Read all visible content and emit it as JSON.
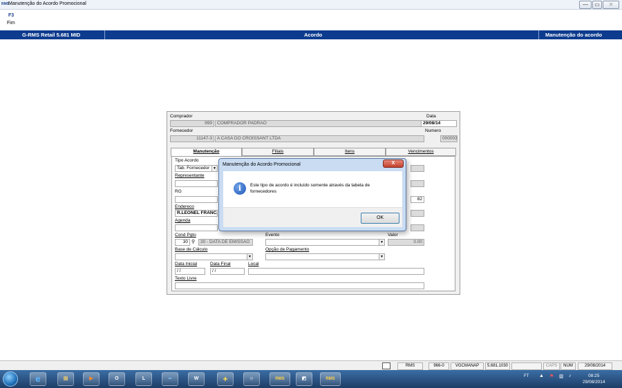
{
  "window": {
    "title": "Manutenção do Acordo Promocional",
    "app_icon": "RMS",
    "minimize": "—",
    "maximize": "▭",
    "close": "✕"
  },
  "toolbar": {
    "key": "F3",
    "label": "Fim"
  },
  "header": {
    "left": "G-RMS Retail 5.681 MID",
    "center": "Acordo",
    "right": "Manutenção do acordo"
  },
  "form": {
    "comprador_label": "Comprador",
    "comprador_code": "999",
    "comprador_name": "COMPRADOR PADRAO",
    "data_label": "Data",
    "data_value": "29/08/14",
    "fornecedor_label": "Fornecedor",
    "fornecedor_code": "11147-3",
    "fornecedor_name": "A CASA DO CROISSANT LTDA",
    "numero_label": "Numero",
    "numero_value": "00000361",
    "tabs": [
      "Manutenção",
      "Filiais",
      "Itens",
      "Vencimentos"
    ],
    "tipo_acordo_label": "Tipo Acordo",
    "tipo_acordo_value": "Tab. Fornecedor",
    "representante_label": "Representante",
    "rg_label": "RG",
    "endereco_label": "Endereco",
    "endereco_value": "R.LEONEL FRANCA",
    "agenda_label": "Agenda",
    "cond_pgto_label": "Cond Pgto",
    "cond_pgto_code": "30",
    "cond_pgto_desc": "30 - DATA DE EMISSAO",
    "evento_label": "Evento",
    "valor_label": "Valor",
    "valor_value": "0.00",
    "base_calculo_label": "Base de Cálculo",
    "opcao_pagamento_label": "Opção de Pagamento",
    "data_inicial_label": "Data Inicial",
    "data_inicial_value": "/ /",
    "data_final_label": "Data Final",
    "data_final_value": "/ /",
    "local_label": "Local",
    "texto_livre_label": "Texto Livre",
    "partial_right_value": "82"
  },
  "dialog": {
    "title": "Manutenção do Acordo Promocional",
    "close": "X",
    "message": "Este tipo de acordo é incluído somente através da tabela de fornecedores",
    "ok": "OK"
  },
  "statusbar": {
    "cells": [
      "RMS",
      "966-0",
      "VGCMANAP",
      "5.681.1030",
      "",
      "CAPS",
      "NUM",
      "29/08/2014"
    ]
  },
  "taskbar": {
    "apps": [
      "e",
      "▤",
      "▶",
      "O",
      "L",
      "∞",
      "W",
      "+",
      "☺",
      "RMS",
      "◩",
      "RMS"
    ],
    "tray_label": "FT",
    "time": "08:25",
    "date": "29/08/2014"
  }
}
